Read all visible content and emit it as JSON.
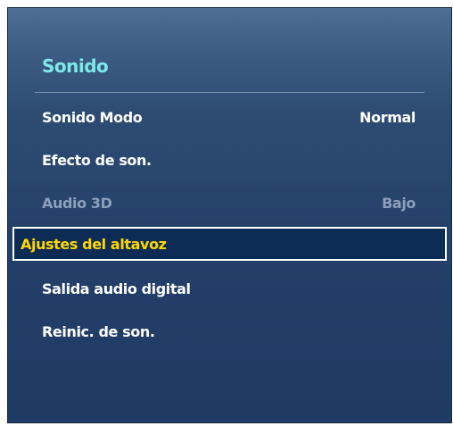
{
  "menu": {
    "title": "Sonido",
    "items": [
      {
        "label": "Sonido Modo",
        "value": "Normal"
      },
      {
        "label": "Efecto de son.",
        "value": ""
      },
      {
        "label": "Audio 3D",
        "value": "Bajo",
        "state": "disabled"
      },
      {
        "label": "Ajustes del altavoz",
        "value": "",
        "state": "selected"
      },
      {
        "label": "Salida audio digital",
        "value": ""
      },
      {
        "label": "Reinic. de son.",
        "value": ""
      }
    ]
  },
  "colors": {
    "title": "#7fe8e8",
    "selected_text": "#ffd700",
    "disabled_text": "#8d9fba",
    "panel": "#2e4c73"
  }
}
